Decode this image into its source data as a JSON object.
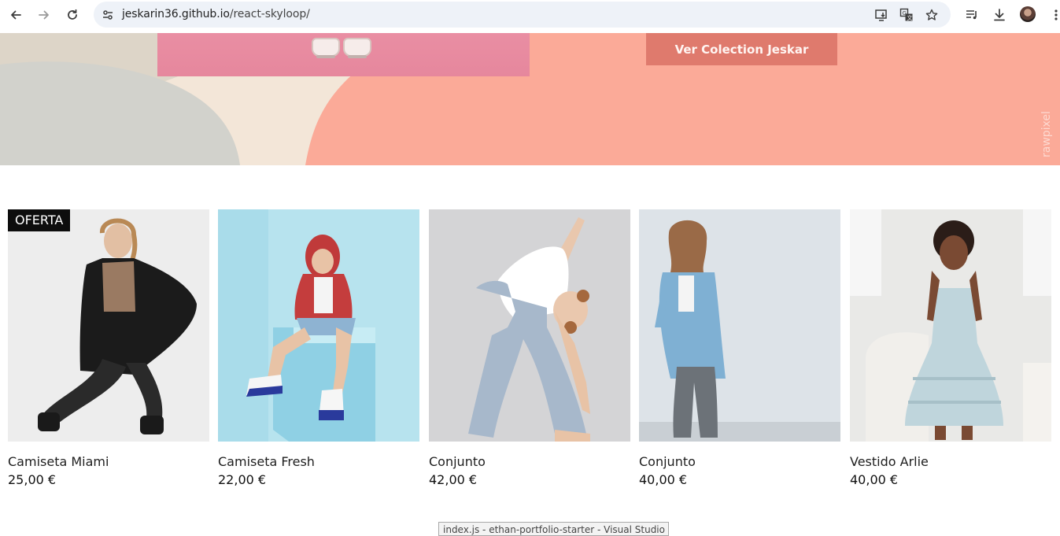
{
  "browser": {
    "url_host": "jeskarin36.github.io",
    "url_path": "/react-skyloop/",
    "icons": [
      "back-arrow-icon",
      "forward-arrow-icon",
      "reload-icon",
      "site-settings-icon",
      "install-app-icon",
      "translate-icon",
      "bookmark-star-icon",
      "media-control-icon",
      "download-icon",
      "profile-avatar",
      "more-vert-icon"
    ]
  },
  "hero": {
    "cta_label": "Ver Colection Jeskar",
    "watermark": "rawpixel",
    "colors": {
      "salmon": "#fbaa98",
      "cta": "#df7a6d",
      "photo_pink": "#e98ea3"
    }
  },
  "products": [
    {
      "name": "Camiseta Miami",
      "price": "25,00 €",
      "badge": "OFERTA",
      "bg": "#ececec"
    },
    {
      "name": "Camiseta Fresh",
      "price": "22,00 €",
      "badge": "",
      "bg": "#b7e3ee"
    },
    {
      "name": "Conjunto",
      "price": "42,00 €",
      "badge": "",
      "bg": "#d4d4d6"
    },
    {
      "name": "Conjunto",
      "price": "40,00 €",
      "badge": "",
      "bg": "#dde3e8"
    },
    {
      "name": "Vestido Arlie",
      "price": "40,00 €",
      "badge": "",
      "bg": "#e9e9e7"
    }
  ],
  "taskbar_tooltip": "index.js - ethan-portfolio-starter - Visual Studio Code"
}
